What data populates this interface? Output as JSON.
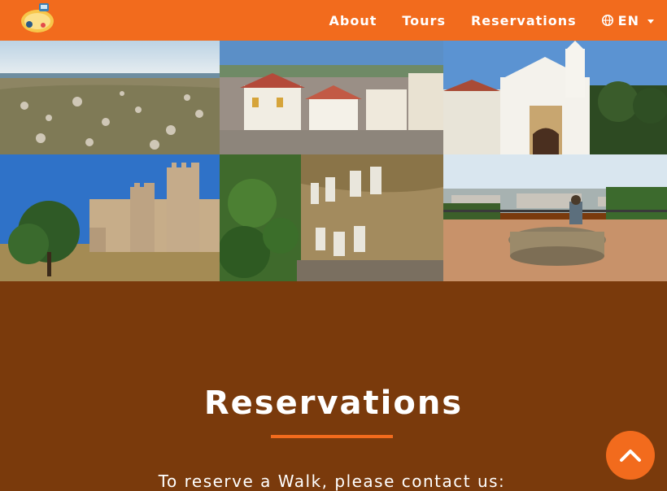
{
  "navbar": {
    "logo": "go-walks-logo",
    "links": [
      {
        "label": "About"
      },
      {
        "label": "Tours"
      },
      {
        "label": "Reservations"
      }
    ],
    "language": {
      "label": "EN",
      "icon": "globe-icon"
    },
    "color": "#f26b1d"
  },
  "gallery": {
    "photos": [
      {
        "name": "coastal-rocky-field-photo"
      },
      {
        "name": "whitewashed-town-rooftops-photo"
      },
      {
        "name": "white-church-facade-photo"
      },
      {
        "name": "castle-walls-photo"
      },
      {
        "name": "stone-wall-plaques-photo"
      },
      {
        "name": "city-viewpoint-bench-photo"
      }
    ]
  },
  "reservations": {
    "title": "Reservations",
    "text": "To reserve a Walk, please contact us:",
    "background": "#7a3a0c",
    "accent": "#f26b1d"
  },
  "back_to_top": {
    "icon": "chevron-up-icon"
  }
}
